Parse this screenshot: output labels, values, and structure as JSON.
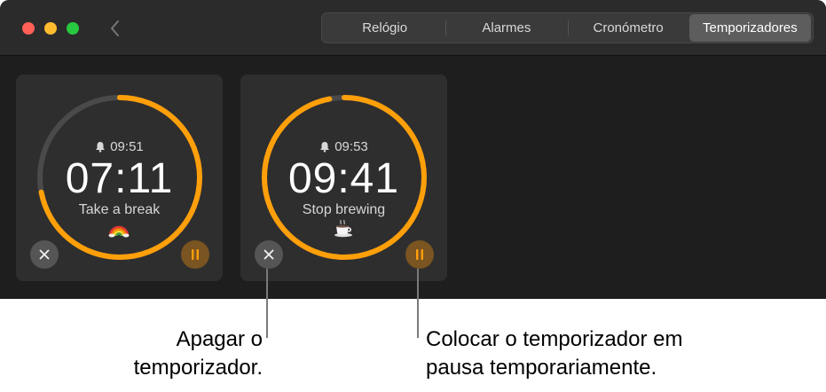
{
  "tabs": [
    {
      "label": "Relógio",
      "active": false
    },
    {
      "label": "Alarmes",
      "active": false
    },
    {
      "label": "Cronómetro",
      "active": false
    },
    {
      "label": "Temporizadores",
      "active": true
    }
  ],
  "timers": [
    {
      "alarm_time": "09:51",
      "remaining": "07:11",
      "label": "Take a break",
      "emoji": "rainbow",
      "progress_remaining": 0.72
    },
    {
      "alarm_time": "09:53",
      "remaining": "09:41",
      "label": "Stop brewing",
      "emoji": "hot-beverage",
      "progress_remaining": 0.97
    }
  ],
  "callouts": {
    "cancel_line1": "Apagar o",
    "cancel_line2": "temporizador.",
    "pause_line1": "Colocar o temporizador em",
    "pause_line2": "pausa temporariamente."
  },
  "colors": {
    "accent": "#ff9f0a",
    "ring_track": "#4a4a4a",
    "card_bg": "#2e2e2e",
    "window_bg": "#1e1e1e"
  }
}
